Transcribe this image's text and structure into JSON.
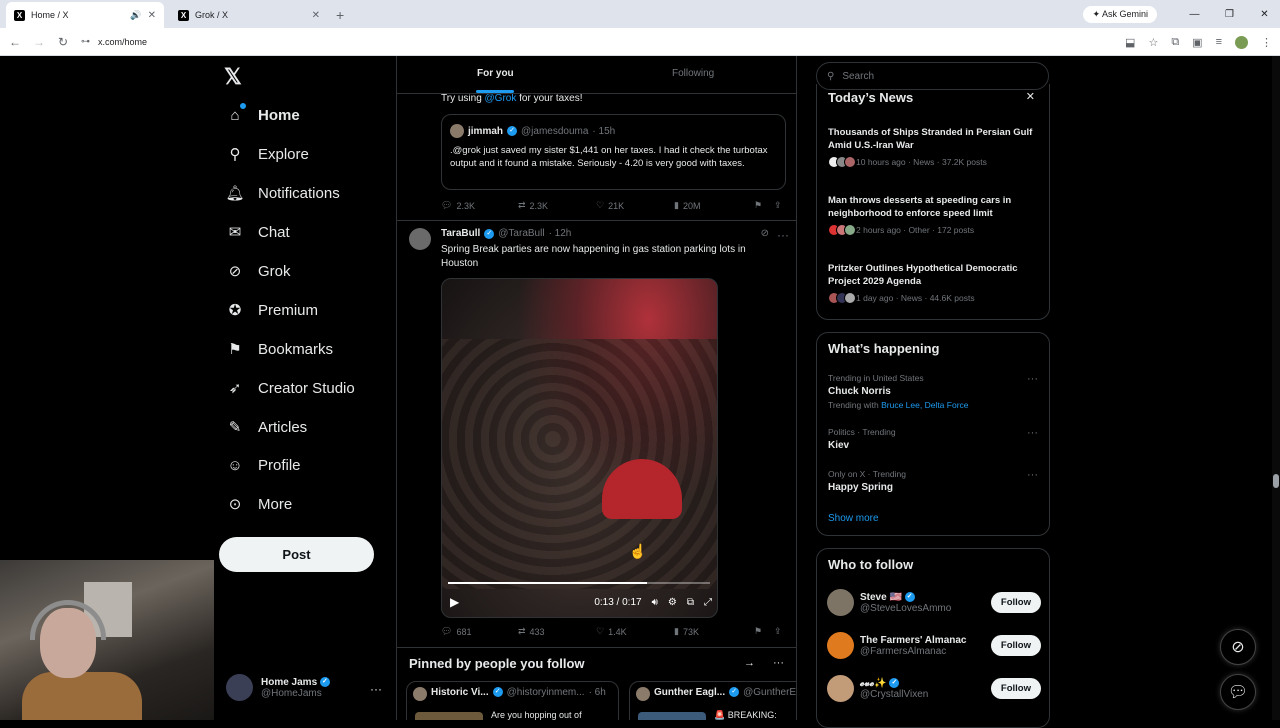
{
  "browser": {
    "tabs": [
      {
        "title": "Home / X",
        "audio": "🔊",
        "active": true
      },
      {
        "title": "Grok / X",
        "active": false
      }
    ],
    "ask_gemini": "Ask Gemini",
    "url": "x.com/home"
  },
  "nav": {
    "items": [
      {
        "label": "Home",
        "icon": "home-icon"
      },
      {
        "label": "Explore",
        "icon": "search-icon"
      },
      {
        "label": "Notifications",
        "icon": "bell-icon"
      },
      {
        "label": "Chat",
        "icon": "mail-icon"
      },
      {
        "label": "Grok",
        "icon": "grok-icon"
      },
      {
        "label": "Premium",
        "icon": "verified-icon"
      },
      {
        "label": "Bookmarks",
        "icon": "bookmark-icon"
      },
      {
        "label": "Creator Studio",
        "icon": "rocket-icon"
      },
      {
        "label": "Articles",
        "icon": "article-icon"
      },
      {
        "label": "Profile",
        "icon": "person-icon"
      },
      {
        "label": "More",
        "icon": "more-circle-icon"
      }
    ],
    "post_label": "Post",
    "account": {
      "name": "Home Jams",
      "handle": "@HomeJams"
    }
  },
  "feed": {
    "tabs": [
      "For you",
      "Following"
    ],
    "tweet1": {
      "text_pre": "Try using ",
      "mention": "@Grok",
      "text_post": " for your taxes!",
      "quote": {
        "name": "jimmah",
        "handle": "@jamesdouma",
        "time": "· 15h",
        "text": ".@grok just saved my sister $1,441 on her taxes.  I had it check the turbotax output and it found a mistake.  Seriously - 4.20 is very good with taxes."
      },
      "stats": {
        "replies": "2.3K",
        "reposts": "2.3K",
        "likes": "21K",
        "views": "20M"
      }
    },
    "tweet2": {
      "name": "TaraBull",
      "handle": "@TaraBull",
      "time": "· 12h",
      "text": "Spring Break parties are now happening in gas station parking lots in Houston",
      "video_time": "0:13 / 0:17",
      "video_progress": 0.76,
      "stats": {
        "replies": "681",
        "reposts": "433",
        "likes": "1.4K",
        "views": "73K"
      }
    },
    "pinned": {
      "title": "Pinned by people you follow",
      "cards": [
        {
          "name": "Historic Vi...",
          "handle": "@historyinmem...",
          "time": "· 6h",
          "text": "Are you hopping out of"
        },
        {
          "name": "Gunther Eagl...",
          "handle": "@GuntherE",
          "text": "🚨 BREAKING:"
        }
      ]
    }
  },
  "sidebar": {
    "search_placeholder": "Search",
    "news": {
      "title": "Today’s News",
      "items": [
        {
          "headline": "Thousands of Ships Stranded in Persian Gulf Amid U.S.-Iran War",
          "meta": "10 hours ago · News · 37.2K posts"
        },
        {
          "headline": "Man throws desserts at speeding cars in neighborhood to enforce speed limit",
          "meta": "2 hours ago · Other · 172 posts"
        },
        {
          "headline": "Pritzker Outlines Hypothetical Democratic Project 2029 Agenda",
          "meta": "1 day ago · News · 44.6K posts"
        }
      ]
    },
    "happening": {
      "title": "What’s happening",
      "trends": [
        {
          "context": "Trending in United States",
          "name": "Chuck Norris",
          "with_label": "Trending with",
          "with_links": "Bruce Lee, Delta Force"
        },
        {
          "context": "Politics · Trending",
          "name": "Kiev"
        },
        {
          "context": "Only on X · Trending",
          "name": "Happy Spring"
        }
      ],
      "show_more": "Show more"
    },
    "who_to_follow": {
      "title": "Who to follow",
      "users": [
        {
          "name": "Steve 🇺🇸",
          "handle": "@SteveLovesAmmo",
          "button": "Follow"
        },
        {
          "name": "The Farmers' Almanac",
          "handle": "@FarmersAlmanac",
          "button": "Follow"
        },
        {
          "name": "𝓮𝓿𝓮✨",
          "handle": "@CrystallVixen",
          "button": "Follow"
        }
      ]
    }
  }
}
